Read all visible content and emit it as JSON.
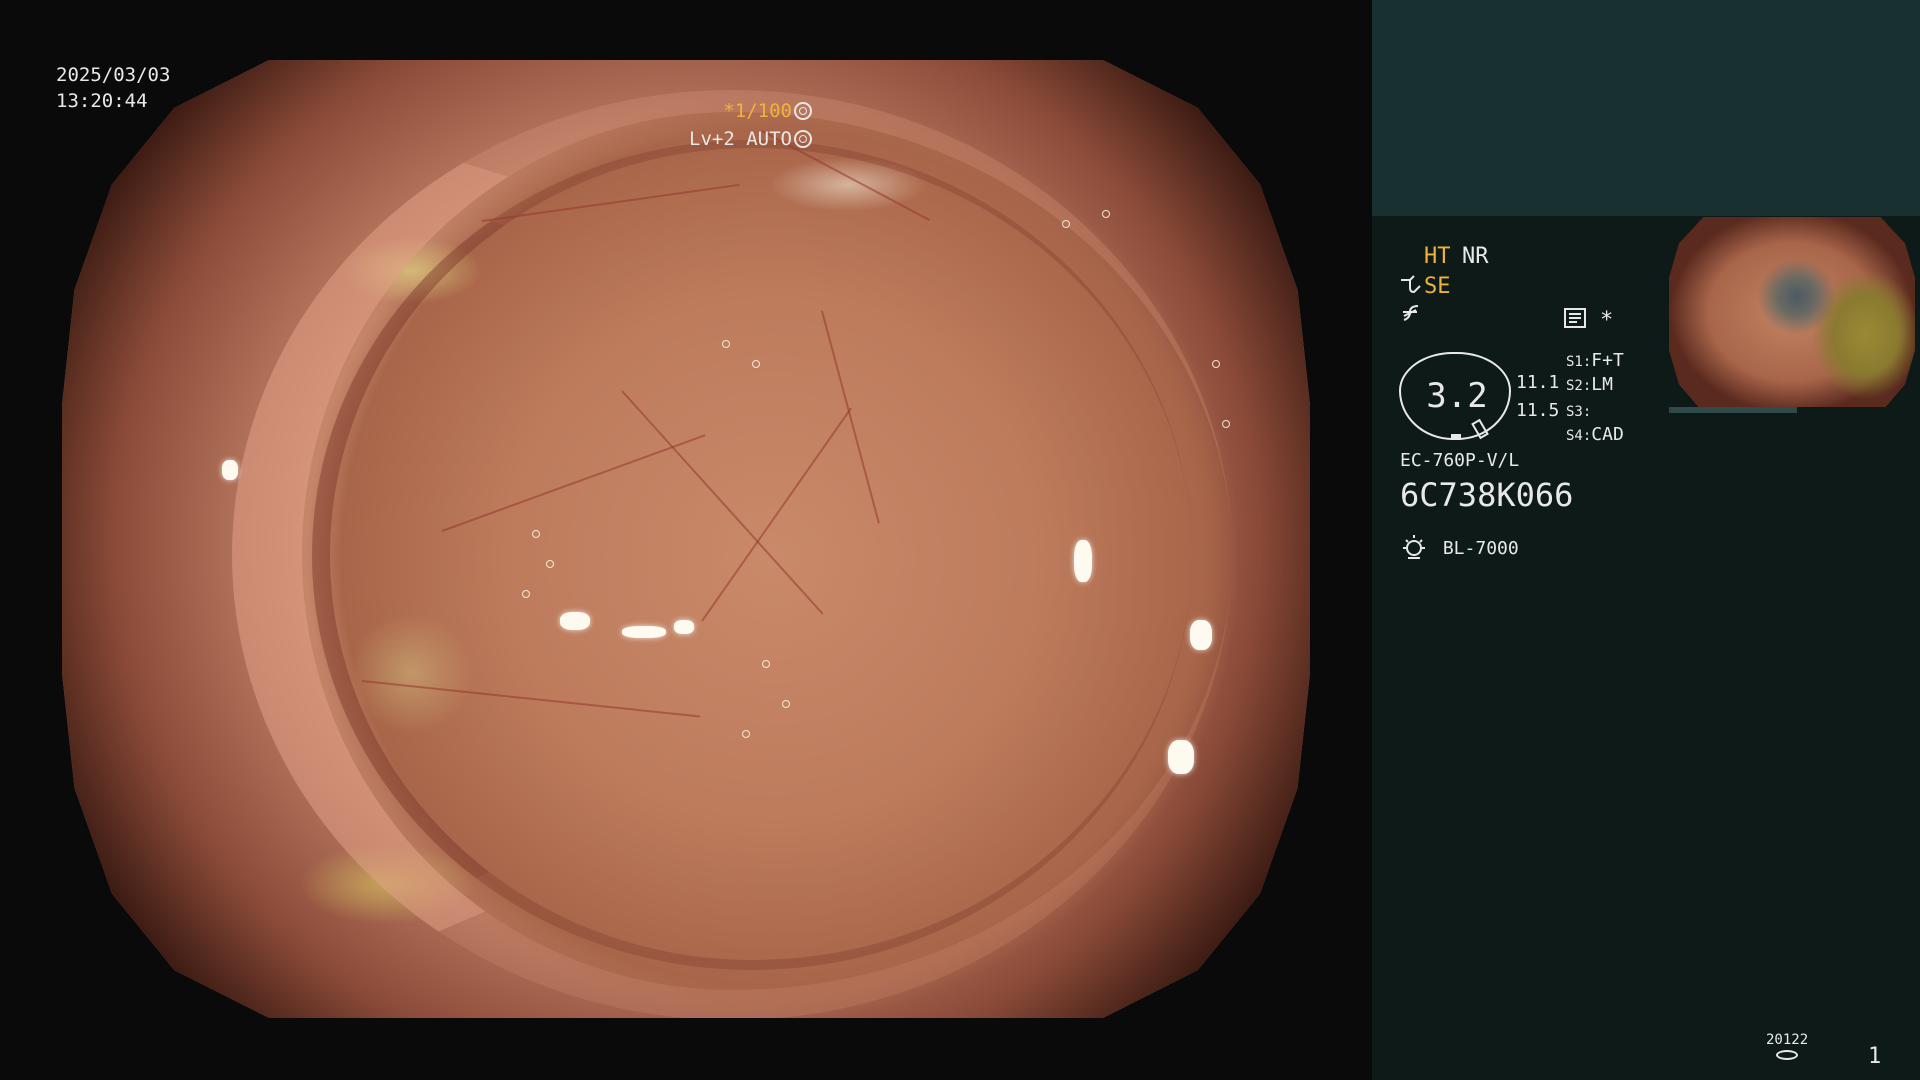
{
  "overlay": {
    "date": "2025/03/03",
    "time": "13:20:44",
    "shutter": "*1/100",
    "enhancement": "Lv+2 AUTO"
  },
  "panel": {
    "ht": "HT",
    "nr": "NR",
    "se": "SE",
    "gauge_value": "3.2",
    "val1": "11.1",
    "val2": "11.5",
    "s1_key": "S1:",
    "s1_val": "F+T",
    "s2_key": "S2:",
    "s2_val": "LM",
    "s3_key": "S3:",
    "s3_val": "",
    "s4_key": "S4:",
    "s4_val": "CAD",
    "asterisk": "*",
    "scope_model": "EC-760P-V/L",
    "serial": "6C738K066",
    "light_source": "BL-7000",
    "storage_count": "20122",
    "page": "1"
  },
  "icons": {
    "shutter": "aperture-icon",
    "enhancement": "gear-icon",
    "scope": "scope-icon",
    "function": "function-icon",
    "memo": "memo-icon",
    "light": "bulb-icon",
    "storage": "disk-icon"
  },
  "colors": {
    "accent": "#f0b23a",
    "panel_top": "#183030",
    "panel_bg": "#0e1a18",
    "text": "#e8e8e8"
  }
}
